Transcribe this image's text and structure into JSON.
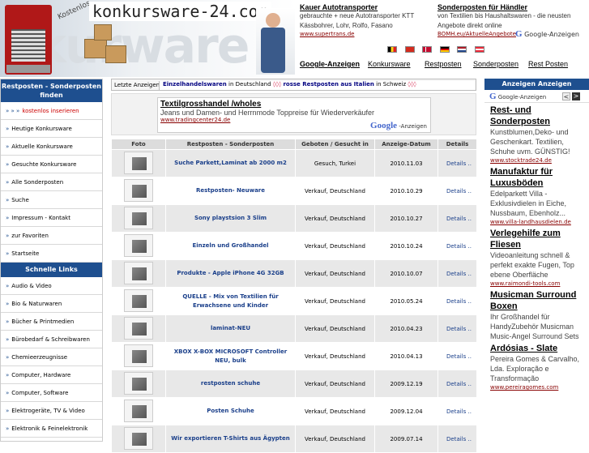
{
  "header": {
    "brand": "konkursware-24.com",
    "brand_tag": "Kostenlos",
    "brand_bg_word": "kurware",
    "top_ads": [
      {
        "title": "Kauer Autotransporter",
        "text": "gebrauchte + neue Autotransporter KTT Kässbohrer, Lohr, Rolfo, Fasano",
        "url": "www.supertrans.de"
      },
      {
        "title": "Sonderposten für Händler",
        "text": "von Textilien bis Haushaltswaren - die neusten Angebote direkt online",
        "url": "BOMH.eu/AktuelleAngebote"
      }
    ],
    "google_ads_label": "Google-Anzeigen",
    "flags": [
      {
        "name": "belgium",
        "colors": [
          "#000000",
          "#f9d616",
          "#e21f26"
        ]
      },
      {
        "name": "switzerland",
        "colors": [
          "#d52b1e",
          "#ffffff",
          "#d52b1e"
        ]
      },
      {
        "name": "denmark",
        "colors": [
          "#c60c30",
          "#ffffff",
          "#c60c30"
        ]
      },
      {
        "name": "germany",
        "colors": [
          "#000000",
          "#dd0000",
          "#ffce00"
        ]
      },
      {
        "name": "netherlands",
        "colors": [
          "#ae1c28",
          "#ffffff",
          "#21468b"
        ]
      },
      {
        "name": "austria",
        "colors": [
          "#ed2939",
          "#ffffff",
          "#ed2939"
        ]
      }
    ],
    "nav": [
      "Google-Anzeigen",
      "Konkursware",
      "Restposten",
      "Sonderposten",
      "Rest Posten"
    ]
  },
  "ticker": {
    "label": "Letzte Anzeigen:",
    "items": [
      {
        "title": "Einzelhandelswaren",
        "loc": "Deutschland"
      },
      {
        "title": "rosse Restposten aus Italien",
        "loc": "Schweiz"
      }
    ],
    "in_word": "in",
    "arrow": "◊◊◊"
  },
  "sidebar": {
    "title": "Restposten - Sonderposten finden",
    "items": [
      {
        "label": "kostenlos inserieren",
        "red": true
      },
      {
        "label": "Heutige Konkursware"
      },
      {
        "label": "Aktuelle Konkursware"
      },
      {
        "label": "Gesuchte Konkursware"
      },
      {
        "label": "Alle Sonderposten"
      },
      {
        "label": "Suche"
      },
      {
        "label": "Impressum - Kontakt"
      },
      {
        "label": "zur Favoriten"
      },
      {
        "label": "Startseite"
      }
    ],
    "quick_title": "Schnelle Links",
    "quick_items": [
      {
        "label": "Audio & Video"
      },
      {
        "label": "Bio & Naturwaren"
      },
      {
        "label": "Bücher & Printmedien"
      },
      {
        "label": "Bürobedarf & Schreibwaren"
      },
      {
        "label": "Chemieerzeugnisse"
      },
      {
        "label": "Computer, Hardware"
      },
      {
        "label": "Computer, Software"
      },
      {
        "label": "Elektrogeräte, TV & Video"
      },
      {
        "label": "Elektronik & Feinelektronik"
      }
    ]
  },
  "text_ad": {
    "title": "Textilgrosshandel /wholes",
    "text": "Jeans und Damen- und Herrnmode Toppreise für Wiederverkäufer",
    "url": "www.tradingcenter24.de",
    "google_label": "Anzeigen"
  },
  "table": {
    "headers": [
      "Foto",
      "Restposten - Sonderposten",
      "Geboten / Gesucht in",
      "Anzeige-Datum",
      "Details"
    ],
    "rows": [
      {
        "title": "Suche Parkett,Laminat ab 2000 m2",
        "where": "Gesuch, Turkei",
        "date": "2010.11.03",
        "details": "Details .."
      },
      {
        "title": "Restposten- Neuware",
        "where": "Verkauf, Deutschland",
        "date": "2010.10.29",
        "details": "Details .."
      },
      {
        "title": "Sony playstsion 3 Slim",
        "where": "Verkauf, Deutschland",
        "date": "2010.10.27",
        "details": "Details .."
      },
      {
        "title": "Einzeln und Großhandel",
        "where": "Verkauf, Deutschland",
        "date": "2010.10.24",
        "details": "Details .."
      },
      {
        "title": "Produkte - Apple iPhone 4G 32GB",
        "where": "Verkauf, Deutschland",
        "date": "2010.10.07",
        "details": "Details .."
      },
      {
        "title": "QUELLE - Mix von Textilien für Erwachsene und Kinder",
        "where": "Verkauf, Deutschland",
        "date": "2010.05.24",
        "details": "Details .."
      },
      {
        "title": "laminat-NEU",
        "where": "Verkauf, Deutschland",
        "date": "2010.04.23",
        "details": "Details .."
      },
      {
        "title": "XBOX X-BOX MICROSOFT Controller NEU, bulk",
        "where": "Verkauf, Deutschland",
        "date": "2010.04.13",
        "details": "Details .."
      },
      {
        "title": "restposten schuhe",
        "where": "Verkauf, Deutschland",
        "date": "2009.12.19",
        "details": "Details .."
      },
      {
        "title": "Posten Schuhe",
        "where": "Verkauf, Deutschland",
        "date": "2009.12.04",
        "details": "Details .."
      },
      {
        "title": "Wir exportieren T-Shirts aus Ägypten",
        "where": "Verkauf, Deutschland",
        "date": "2009.07.14",
        "details": "Details .."
      }
    ]
  },
  "right": {
    "title": "Anzeigen Anzeigen",
    "google_label": "Google-Anzeigen",
    "prev": "<",
    "next": ">",
    "ads": [
      {
        "title": "Rest- und Sonderposten",
        "text": "Kunstblumen,Deko- und Geschenkart. Textilien, Schuhe uvm. GÜNSTIG!",
        "url": "www.stocktrade24.de"
      },
      {
        "title": "Manufaktur für Luxusböden",
        "text": "Edelparkett Villa - Exklusivdielen in Eiche, Nussbaum, Ebenholz...",
        "url": "www.villa-landhausdielen.de"
      },
      {
        "title": "Verlegehilfe zum Fliesen",
        "text": "Videoanleitung schnell & perfekt exakte Fugen, Top ebene Oberfläche",
        "url": "www.raimondi-tools.com"
      },
      {
        "title": "Musicman Surround Boxen",
        "text": "Ihr Großhandel für HandyZubehör Musicman Music-Angel Surround Sets",
        "url": ""
      },
      {
        "title": "Ardósias - Slate",
        "text": "Pereira Gomes & Carvalho, Lda. Exploração e Transformação",
        "url": "www.pereiragomes.com"
      }
    ]
  }
}
